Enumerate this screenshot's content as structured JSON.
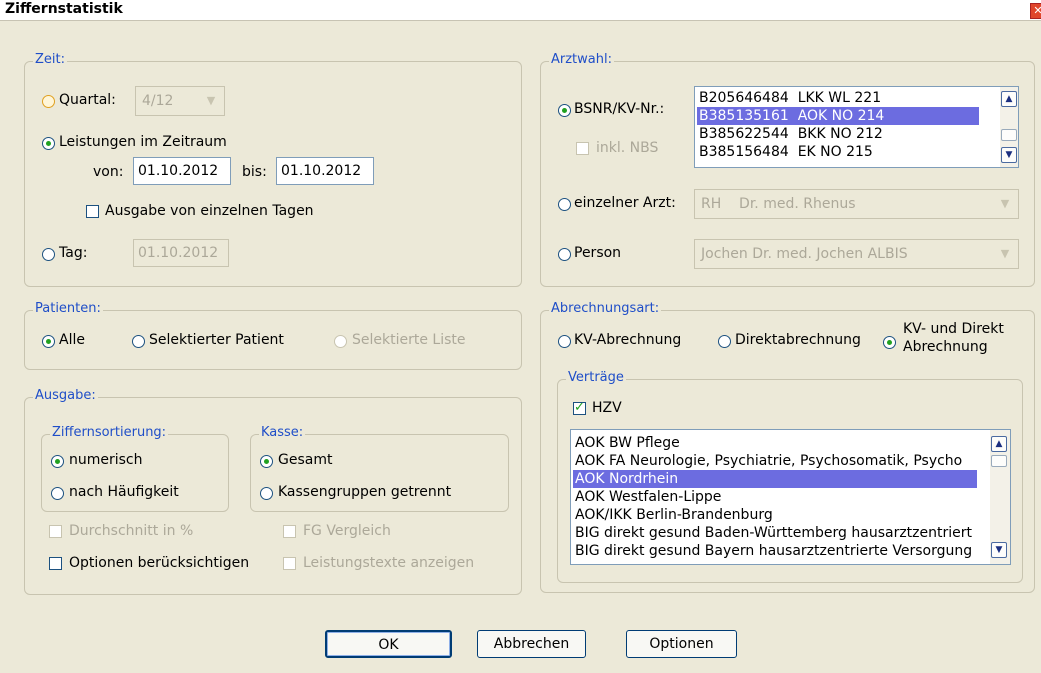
{
  "window": {
    "title": "Ziffernstatistik",
    "close_glyph": "✕"
  },
  "zeit": {
    "legend": "Zeit:",
    "quartal_label": "Quartal:",
    "quartal_value": "4/12",
    "leistungen_label": "Leistungen im Zeitraum",
    "von_label": "von:",
    "von_value": "01.10.2012",
    "bis_label": "bis:",
    "bis_value": "01.10.2012",
    "einzelne_tage_label": "Ausgabe von einzelnen Tagen",
    "tag_label": "Tag:",
    "tag_value": "01.10.2012"
  },
  "arztwahl": {
    "legend": "Arztwahl:",
    "bsnr_label": "BSNR/KV-Nr.:",
    "inkl_nbs_label": "inkl. NBS",
    "bsnr_rows": [
      {
        "nr": "B205646484",
        "kv": "LKK WL 221"
      },
      {
        "nr": "B385135161",
        "kv": "AOK NO 214"
      },
      {
        "nr": "B385622544",
        "kv": "BKK NO 212"
      },
      {
        "nr": "B385156484",
        "kv": "EK NO 215"
      }
    ],
    "einzelner_arzt_label": "einzelner Arzt:",
    "arzt_value": "RH    Dr. med. Rhenus",
    "person_label": "Person",
    "person_value": "Jochen Dr. med. Jochen ALBIS"
  },
  "patienten": {
    "legend": "Patienten:",
    "alle_label": "Alle",
    "selektierter_label": "Selektierter Patient",
    "liste_label": "Selektierte Liste"
  },
  "abrechnungsart": {
    "legend": "Abrechnungsart:",
    "kv_label": "KV-Abrechnung",
    "direkt_label": "Direktabrechnung",
    "kv_direkt_line1": "KV- und Direkt",
    "kv_direkt_line2": "Abrechnung"
  },
  "vertraege": {
    "legend": "Verträge",
    "hzv_label": "HZV",
    "items": [
      "AOK BW Pflege",
      "AOK FA Neurologie, Psychiatrie, Psychosomatik, Psycho",
      "AOK Nordrhein",
      "AOK Westfalen-Lippe",
      "AOK/IKK Berlin-Brandenburg",
      "BIG direkt gesund Baden-Württemberg hausarztzentriert",
      "BIG direkt gesund Bayern hausarztzentrierte Versorgung"
    ]
  },
  "ausgabe": {
    "legend": "Ausgabe:",
    "sortierung_legend": "Ziffernsortierung:",
    "numerisch_label": "numerisch",
    "haeufigkeit_label": "nach Häufigkeit",
    "kasse_legend": "Kasse:",
    "gesamt_label": "Gesamt",
    "kassengruppen_label": "Kassengruppen getrennt",
    "durchschnitt_label": "Durchschnitt in %",
    "fg_label": "FG Vergleich",
    "optionen_label": "Optionen berücksichtigen",
    "leistungstexte_label": "Leistungstexte anzeigen"
  },
  "buttons": {
    "ok": "OK",
    "abbrechen": "Abbrechen",
    "optionen": "Optionen"
  },
  "icons": {
    "dropdown": "▼",
    "scroll_up": "▲",
    "scroll_down": "▼"
  }
}
